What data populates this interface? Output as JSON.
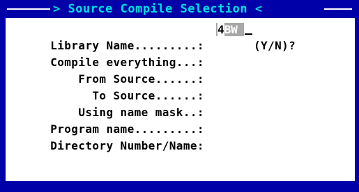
{
  "window": {
    "title": "> Source Compile Selection <",
    "colors": {
      "frame": "#0000a8",
      "title_text": "#00e0e0",
      "field_background": "#a8a8a8",
      "background": "#ffffff",
      "text": "#000000"
    }
  },
  "form": {
    "library_name_label": "Library Name.........:",
    "library_name_value_first": "4",
    "library_name_value_rest": "BW",
    "compile_everything_label": "Compile everything...:",
    "compile_everything_prompt": "(Y/N)?",
    "from_source_label": "    From Source......:",
    "to_source_label": "      To Source......:",
    "using_name_mask_label": "    Using name mask..:",
    "program_name_label": "Program name.........:",
    "directory_label": "Directory Number/Name:"
  }
}
